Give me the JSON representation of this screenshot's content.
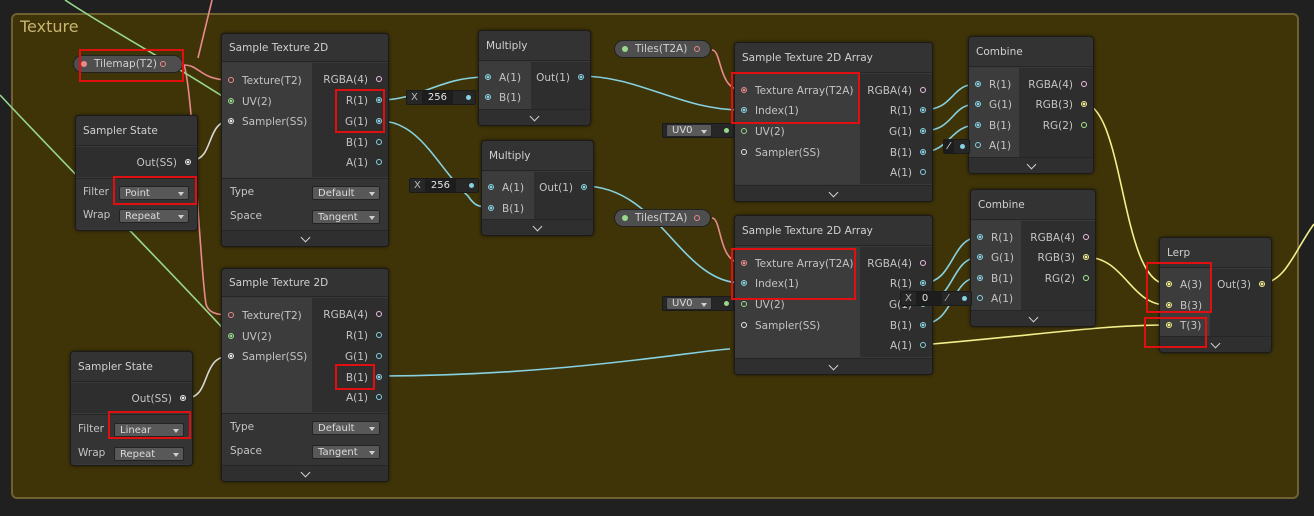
{
  "group": {
    "title": "Texture"
  },
  "properties": {
    "tilemap": "Tilemap(T2)",
    "tiles_a": "Tiles(T2A)",
    "tiles_b": "Tiles(T2A)"
  },
  "sample_texture_2d_top": {
    "title": "Sample Texture 2D",
    "inputs": [
      "Texture(T2)",
      "UV(2)",
      "Sampler(SS)"
    ],
    "outputs": [
      "RGBA(4)",
      "R(1)",
      "G(1)",
      "B(1)",
      "A(1)"
    ],
    "type_label": "Type",
    "type_value": "Default",
    "space_label": "Space",
    "space_value": "Tangent"
  },
  "sample_texture_2d_bottom": {
    "title": "Sample Texture 2D",
    "inputs": [
      "Texture(T2)",
      "UV(2)",
      "Sampler(SS)"
    ],
    "outputs": [
      "RGBA(4)",
      "R(1)",
      "G(1)",
      "B(1)",
      "A(1)"
    ],
    "type_label": "Type",
    "type_value": "Default",
    "space_label": "Space",
    "space_value": "Tangent"
  },
  "sampler_state_top": {
    "title": "Sampler State",
    "output": "Out(SS)",
    "filter_label": "Filter",
    "filter_value": "Point",
    "wrap_label": "Wrap",
    "wrap_value": "Repeat"
  },
  "sampler_state_bottom": {
    "title": "Sampler State",
    "output": "Out(SS)",
    "filter_label": "Filter",
    "filter_value": "Linear",
    "wrap_label": "Wrap",
    "wrap_value": "Repeat"
  },
  "multiply_top": {
    "title": "Multiply",
    "inputs": [
      "A(1)",
      "B(1)"
    ],
    "output": "Out(1)"
  },
  "multiply_bottom": {
    "title": "Multiply",
    "inputs": [
      "A(1)",
      "B(1)"
    ],
    "output": "Out(1)"
  },
  "inline_values": {
    "x_label": "X",
    "b_top": "256",
    "a_bottom": "256",
    "combine_r": "0"
  },
  "uv_dropdowns": {
    "top": "UV0",
    "bottom": "UV0"
  },
  "sample_array_top": {
    "title": "Sample Texture 2D Array",
    "inputs": [
      "Texture Array(T2A)",
      "Index(1)",
      "UV(2)",
      "Sampler(SS)"
    ],
    "outputs": [
      "RGBA(4)",
      "R(1)",
      "G(1)",
      "B(1)",
      "A(1)"
    ]
  },
  "sample_array_bottom": {
    "title": "Sample Texture 2D Array",
    "inputs": [
      "Texture Array(T2A)",
      "Index(1)",
      "UV(2)",
      "Sampler(SS)"
    ],
    "outputs": [
      "RGBA(4)",
      "R(1)",
      "G(1)",
      "B(1)",
      "A(1)"
    ]
  },
  "combine_top": {
    "title": "Combine",
    "inputs": [
      "R(1)",
      "G(1)",
      "B(1)",
      "A(1)"
    ],
    "outputs": [
      "RGBA(4)",
      "RGB(3)",
      "RG(2)"
    ]
  },
  "combine_bottom": {
    "title": "Combine",
    "inputs": [
      "R(1)",
      "G(1)",
      "B(1)",
      "A(1)"
    ],
    "outputs": [
      "RGBA(4)",
      "RGB(3)",
      "RG(2)"
    ]
  },
  "lerp": {
    "title": "Lerp",
    "inputs": [
      "A(3)",
      "B(3)",
      "T(3)"
    ],
    "output": "Out(3)"
  },
  "colors": {
    "group_fill": "#3f3308",
    "group_border": "#6e6030",
    "highlight": "#e01010",
    "wire_texture": "#e88a8a",
    "wire_uv": "#97d88a",
    "wire_float": "#86d2e2",
    "wire_vector3": "#f3ef8c"
  }
}
